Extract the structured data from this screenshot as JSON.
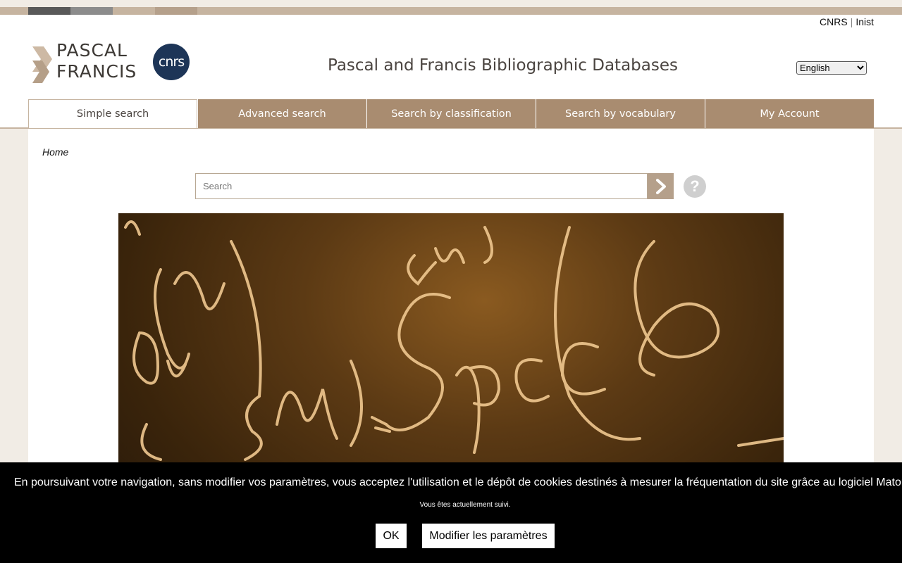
{
  "header": {
    "top_links": [
      "CNRS",
      "Inist"
    ],
    "logo": {
      "word1": "PASCAL",
      "word2": "FRANCIS",
      "badge": "cnrs"
    },
    "site_title": "Pascal and Francis Bibliographic Databases",
    "language": {
      "selected": "English"
    }
  },
  "nav": {
    "tabs": [
      {
        "label": "Simple search",
        "active": true
      },
      {
        "label": "Advanced search",
        "active": false
      },
      {
        "label": "Search by classification",
        "active": false
      },
      {
        "label": "Search by vocabulary",
        "active": false
      },
      {
        "label": "My Account",
        "active": false
      }
    ]
  },
  "main": {
    "breadcrumb": "Home",
    "search": {
      "placeholder": "Search",
      "value": ""
    },
    "help_label": "?"
  },
  "cookie": {
    "text": "En poursuivant votre navigation, sans modifier vos paramètres, vous acceptez l'utilisation et le dépôt de cookies destinés à mesurer la fréquentation du site grâce au logiciel Matomo.",
    "status": "Vous êtes actuellement suivi.",
    "ok_label": "OK",
    "modify_label": "Modifier les paramètres"
  },
  "colors": {
    "accent": "#a98c70",
    "strip": "#c6b4a0",
    "cnrs_badge": "#1d3557",
    "cookie_bg": "#000000"
  }
}
